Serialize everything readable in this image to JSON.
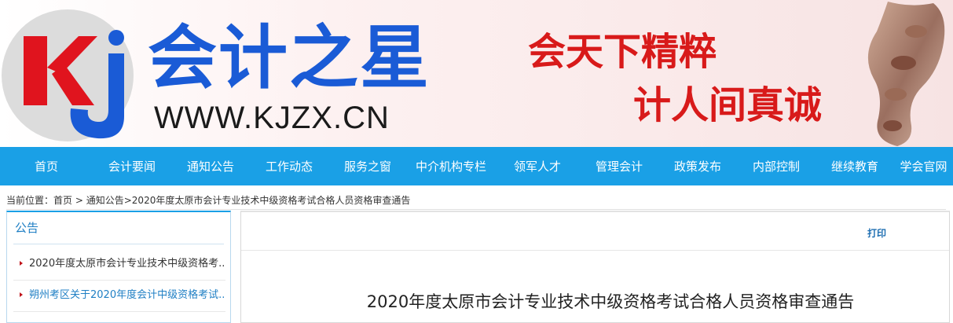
{
  "header": {
    "logo_letters": "Kj",
    "brand_name": "会计之星",
    "brand_url": "WWW.KJZX.CN",
    "slogan_line1": "会天下精粹",
    "slogan_line2": "计人间真诚"
  },
  "nav": {
    "items": [
      "首页",
      "会计要闻",
      "通知公告",
      "工作动态",
      "服务之窗",
      "中介机构专栏",
      "领军人才",
      "管理会计",
      "政策发布",
      "内部控制",
      "继续教育",
      "学会官网"
    ]
  },
  "breadcrumb": {
    "prefix": "当前位置：",
    "home": "首页",
    "sep1": " > ",
    "section": "通知公告",
    "sep2": ">",
    "current": "2020年度太原市会计专业技术中级资格考试合格人员资格审查通告"
  },
  "sidebar": {
    "title": "公告",
    "items": [
      "2020年度太原市会计专业技术中级资格考...",
      "朔州考区关于2020年度会计中级资格考试..."
    ]
  },
  "article": {
    "print_label": "打印",
    "title": "2020年度太原市会计专业技术中级资格考试合格人员资格审查通告"
  },
  "colors": {
    "nav_bg": "#1aa0e6",
    "brand_blue": "#1a5bd6",
    "slogan_red": "#d81a1a",
    "logo_red": "#e0141e"
  },
  "icons": {
    "logo": "kj-logo",
    "ornament": "carved-relief-ornament",
    "bullet": "triangle-bullet-icon"
  }
}
